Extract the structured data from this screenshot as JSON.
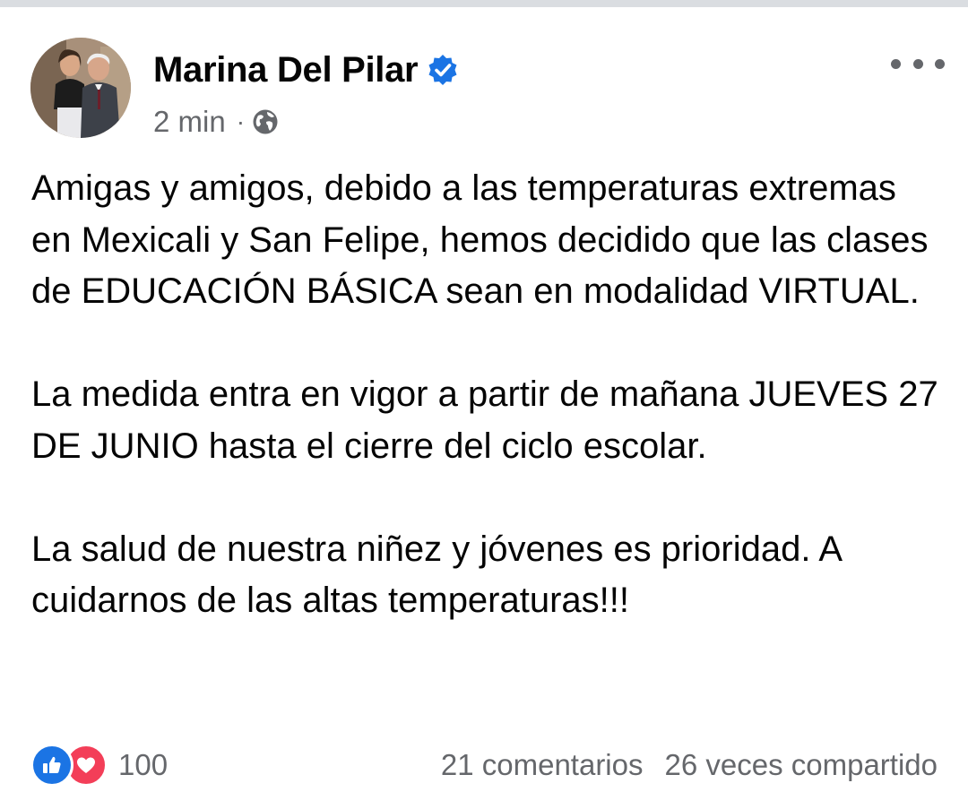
{
  "post": {
    "author": {
      "name": "Marina Del Pilar",
      "verified": true
    },
    "meta": {
      "time": "2 min",
      "separator": "·",
      "audience_icon": "globe-icon"
    },
    "more_icon": "more-options-icon",
    "body": [
      "Amigas y amigos, debido a las temperaturas extremas en Mexicali y San Felipe, hemos decidido que las clases de EDUCACIÓN BÁSICA sean en modalidad VIRTUAL.",
      "La medida entra en vigor a partir de mañana JUEVES 27 DE JUNIO hasta el cierre del ciclo escolar.",
      "La salud de nuestra niñez y jóvenes es prioridad. A cuidarnos de las altas temperaturas!!!"
    ],
    "footer": {
      "reactions": [
        "like-icon",
        "love-icon"
      ],
      "reaction_count": "100",
      "comments": "21 comentarios",
      "shares": "26 veces compartido"
    }
  },
  "colors": {
    "text": "#050505",
    "secondary": "#65676b",
    "verified": "#1b74e4",
    "like": "#1b74e4",
    "love": "#f33e58",
    "divider": "#dadde1"
  }
}
